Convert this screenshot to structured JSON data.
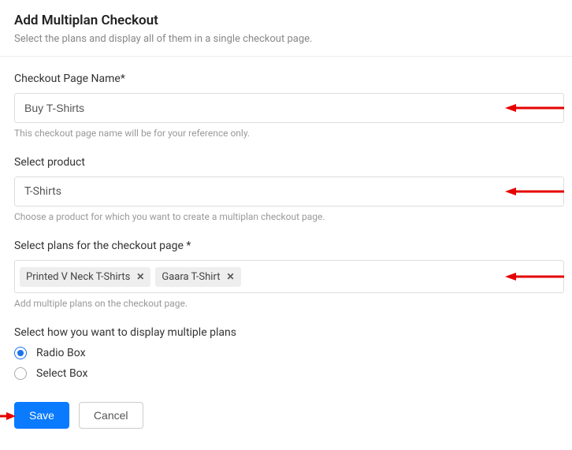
{
  "header": {
    "title": "Add Multiplan Checkout",
    "subtitle": "Select the plans and display all of them in a single checkout page."
  },
  "form": {
    "pageName": {
      "label": "Checkout Page Name*",
      "value": "Buy T-Shirts",
      "helper": "This checkout page name will be for your reference only."
    },
    "product": {
      "label": "Select product",
      "value": "T-Shirts",
      "helper": "Choose a product for which you want to create a multiplan checkout page."
    },
    "plans": {
      "label": "Select plans for the checkout page *",
      "tags": [
        {
          "label": "Printed V Neck T-Shirts"
        },
        {
          "label": "Gaara T-Shirt"
        }
      ],
      "helper": "Add multiple plans on the checkout page."
    },
    "displayMode": {
      "label": "Select how you want to display multiple plans",
      "options": [
        {
          "label": "Radio Box",
          "checked": true
        },
        {
          "label": "Select Box",
          "checked": false
        }
      ]
    }
  },
  "buttons": {
    "save": "Save",
    "cancel": "Cancel"
  },
  "annotations": {
    "arrowColor": "#e60000"
  }
}
